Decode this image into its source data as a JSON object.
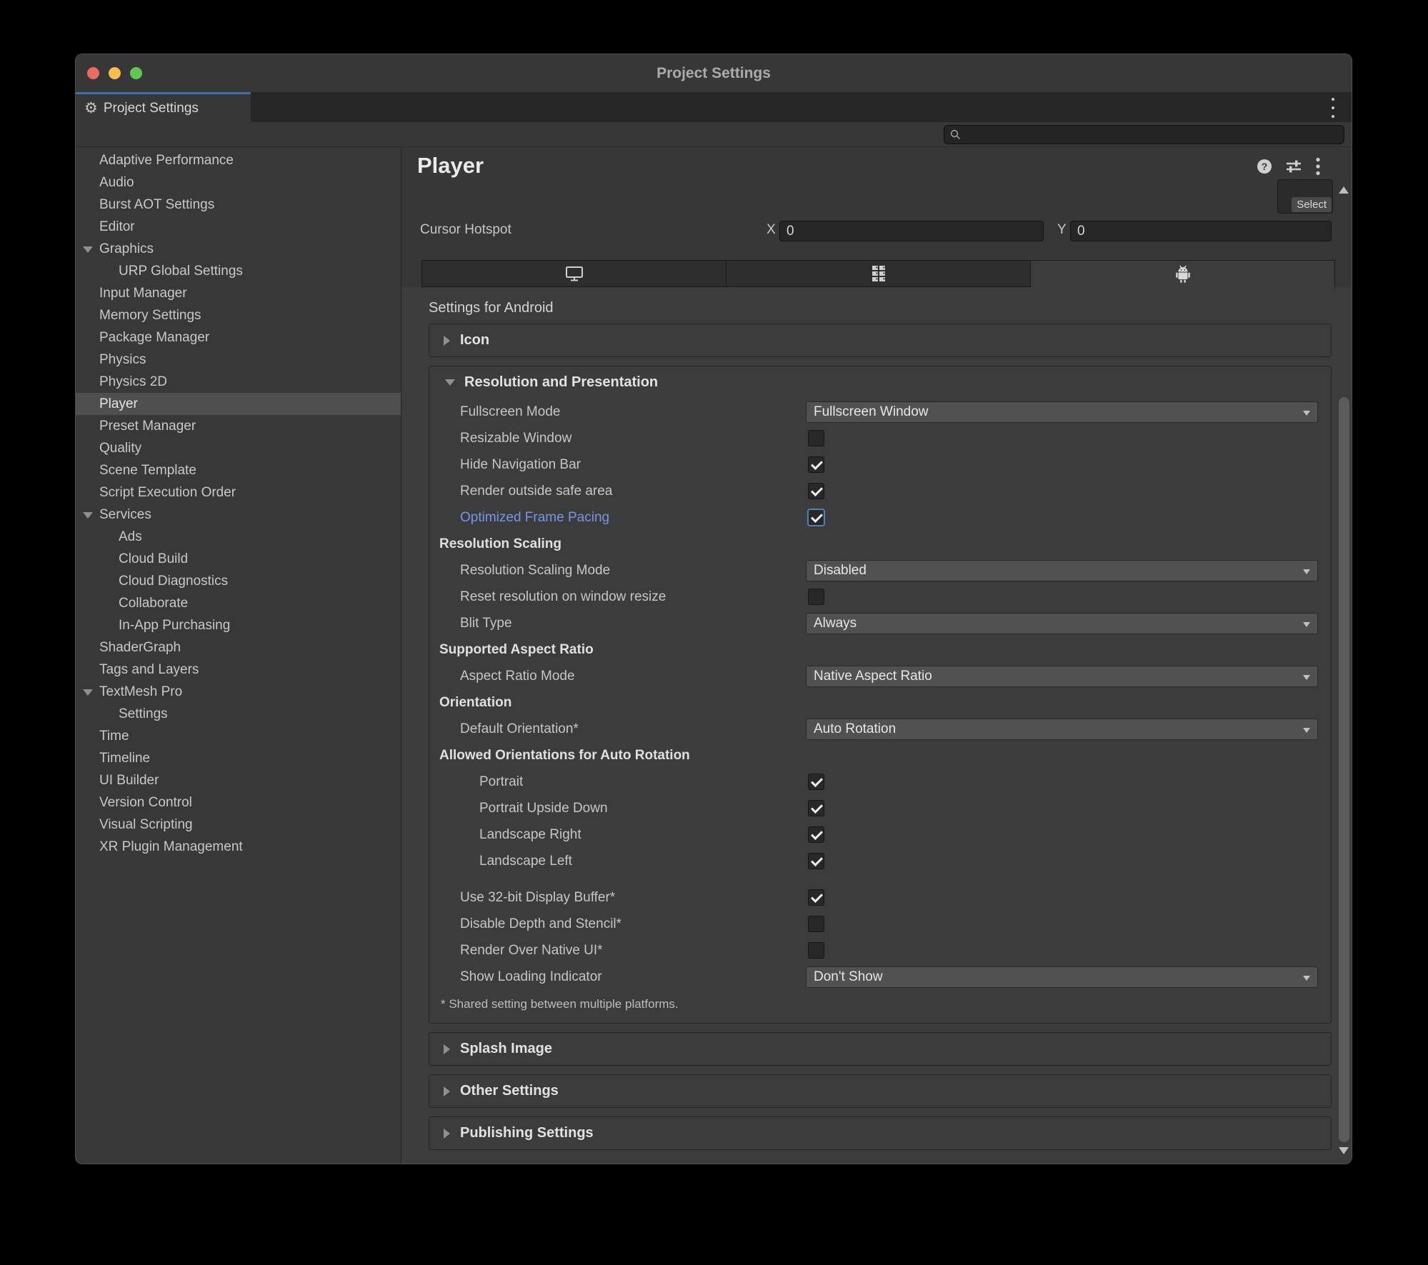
{
  "window": {
    "title": "Project Settings"
  },
  "dock_tab": {
    "label": "Project Settings"
  },
  "sidebar": {
    "items": [
      {
        "label": "Adaptive Performance"
      },
      {
        "label": "Audio"
      },
      {
        "label": "Burst AOT Settings"
      },
      {
        "label": "Editor"
      },
      {
        "label": "Graphics",
        "arrow": true
      },
      {
        "label": "URP Global Settings",
        "level": 1
      },
      {
        "label": "Input Manager"
      },
      {
        "label": "Memory Settings"
      },
      {
        "label": "Package Manager"
      },
      {
        "label": "Physics"
      },
      {
        "label": "Physics 2D"
      },
      {
        "label": "Player",
        "selected": true
      },
      {
        "label": "Preset Manager"
      },
      {
        "label": "Quality"
      },
      {
        "label": "Scene Template"
      },
      {
        "label": "Script Execution Order"
      },
      {
        "label": "Services",
        "arrow": true
      },
      {
        "label": "Ads",
        "level": 1
      },
      {
        "label": "Cloud Build",
        "level": 1
      },
      {
        "label": "Cloud Diagnostics",
        "level": 1
      },
      {
        "label": "Collaborate",
        "level": 1
      },
      {
        "label": "In-App Purchasing",
        "level": 1
      },
      {
        "label": "ShaderGraph"
      },
      {
        "label": "Tags and Layers"
      },
      {
        "label": "TextMesh Pro",
        "arrow": true
      },
      {
        "label": "Settings",
        "level": 1
      },
      {
        "label": "Time"
      },
      {
        "label": "Timeline"
      },
      {
        "label": "UI Builder"
      },
      {
        "label": "Version Control"
      },
      {
        "label": "Visual Scripting"
      },
      {
        "label": "XR Plugin Management"
      }
    ]
  },
  "header": {
    "title": "Player",
    "select_label": "Select"
  },
  "cursor_hotspot": {
    "label": "Cursor Hotspot",
    "x_label": "X",
    "x_value": "0",
    "y_label": "Y",
    "y_value": "0"
  },
  "platform_tabs": [
    {
      "name": "desktop",
      "active": false
    },
    {
      "name": "dedicated-server",
      "active": false
    },
    {
      "name": "android",
      "active": true
    }
  ],
  "settings_for": "Settings for Android",
  "foldouts": {
    "icon": "Icon",
    "resolution": "Resolution and Presentation",
    "splash": "Splash Image",
    "other": "Other Settings",
    "publishing": "Publishing Settings"
  },
  "resolution_rows": [
    {
      "type": "dropdown",
      "label": "Fullscreen Mode",
      "value": "Fullscreen Window"
    },
    {
      "type": "checkbox",
      "label": "Resizable Window",
      "checked": false
    },
    {
      "type": "checkbox",
      "label": "Hide Navigation Bar",
      "checked": true
    },
    {
      "type": "checkbox",
      "label": "Render outside safe area",
      "checked": true
    },
    {
      "type": "checkbox",
      "label": "Optimized Frame Pacing",
      "checked": true,
      "highlight": true
    },
    {
      "type": "header",
      "label": "Resolution Scaling"
    },
    {
      "type": "dropdown",
      "label": "Resolution Scaling Mode",
      "value": "Disabled"
    },
    {
      "type": "checkbox",
      "label": "Reset resolution on window resize",
      "checked": false
    },
    {
      "type": "dropdown",
      "label": "Blit Type",
      "value": "Always"
    },
    {
      "type": "header",
      "label": "Supported Aspect Ratio"
    },
    {
      "type": "dropdown",
      "label": "Aspect Ratio Mode",
      "value": "Native Aspect Ratio"
    },
    {
      "type": "header",
      "label": "Orientation"
    },
    {
      "type": "dropdown",
      "label": "Default Orientation*",
      "value": "Auto Rotation"
    },
    {
      "type": "header",
      "label": "Allowed Orientations for Auto Rotation"
    },
    {
      "type": "checkbox",
      "label": "Portrait",
      "checked": true,
      "indent": 2
    },
    {
      "type": "checkbox",
      "label": "Portrait Upside Down",
      "checked": true,
      "indent": 2
    },
    {
      "type": "checkbox",
      "label": "Landscape Right",
      "checked": true,
      "indent": 2
    },
    {
      "type": "checkbox",
      "label": "Landscape Left",
      "checked": true,
      "indent": 2
    },
    {
      "type": "spacer"
    },
    {
      "type": "checkbox",
      "label": "Use 32-bit Display Buffer*",
      "checked": true
    },
    {
      "type": "checkbox",
      "label": "Disable Depth and Stencil*",
      "checked": false
    },
    {
      "type": "checkbox",
      "label": "Render Over Native UI*",
      "checked": false
    },
    {
      "type": "dropdown",
      "label": "Show Loading Indicator",
      "value": "Don't Show"
    },
    {
      "type": "note",
      "label": "* Shared setting between multiple platforms."
    }
  ],
  "colors": {
    "accent_tab_blue": "#3E6FB5",
    "highlight_blue": "#7497E5",
    "traffic_red": "#EC6A5E",
    "traffic_yellow": "#F5BF4F",
    "traffic_green": "#62C554"
  }
}
